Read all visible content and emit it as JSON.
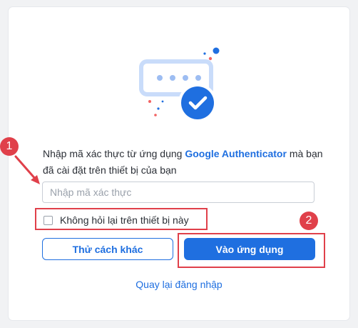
{
  "verification": {
    "message_prefix": "Nhập mã xác thực từ ứng dụng",
    "app_name": "Google Authenticator",
    "message_suffix": "mà bạn đã cài đặt trên thiết bị của bạn",
    "code_placeholder": "Nhập mã xác thực",
    "code_value": "",
    "remember_label": "Không hỏi lại trên thiết bị này",
    "remember_checked": false,
    "try_other_label": "Thử cách khác",
    "submit_label": "Vào ứng dụng",
    "back_link": "Quay lại đăng nhập"
  },
  "annotations": {
    "step1": "1",
    "step2": "2",
    "color": "#e0404a"
  },
  "colors": {
    "brand": "#1f6fe0",
    "text": "#2b2f36",
    "background": "#f1f2f4"
  },
  "icons": [
    "otp-dots-icon",
    "check-circle-icon"
  ]
}
